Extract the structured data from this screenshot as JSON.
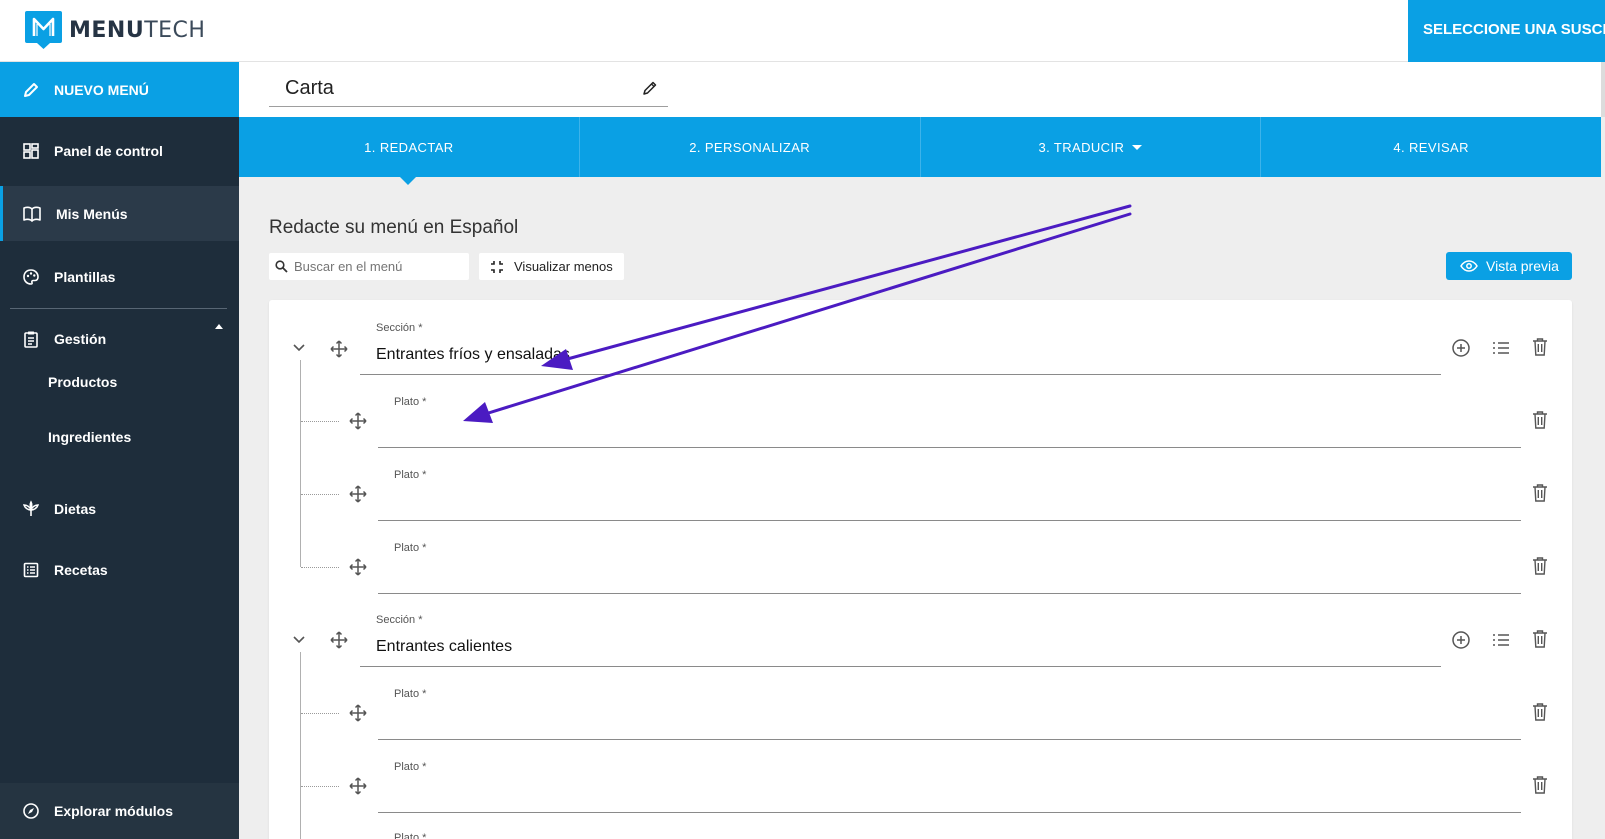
{
  "header": {
    "brand_bold": "MENU",
    "brand_rest": "TECH",
    "subscription_label": "SELECCIONE UNA SUSCRI"
  },
  "sidebar": {
    "new_menu_label": "NUEVO MENÚ",
    "items": {
      "dashboard": "Panel de control",
      "my_menus": "Mis Menús",
      "templates": "Plantillas",
      "management": "Gestión",
      "products": "Productos",
      "ingredients": "Ingredientes",
      "diets": "Dietas",
      "recipes": "Recetas"
    },
    "explore_label": "Explorar módulos",
    "active": "my_menus"
  },
  "menu": {
    "title": "Carta"
  },
  "steps": {
    "s1": "1. REDACTAR",
    "s2": "2. PERSONALIZAR",
    "s3": "3. TRADUCIR",
    "s4": "4. REVISAR",
    "active": "s1"
  },
  "editor": {
    "heading": "Redacte su menú en Español",
    "search_placeholder": "Buscar en el menú",
    "view_less_label": "Visualizar menos",
    "preview_label": "Vista previa",
    "section_label": "Sección *",
    "dish_label": "Plato *",
    "sections": [
      {
        "name": "Entrantes fríos y ensaladas",
        "dishes": [
          "",
          "",
          ""
        ]
      },
      {
        "name": "Entrantes calientes",
        "dishes": [
          "",
          "",
          ""
        ]
      }
    ]
  },
  "colors": {
    "accent": "#0aa0e4",
    "sidebar_bg": "#1e2d3b",
    "annotation_arrow": "#4b1bc2"
  }
}
